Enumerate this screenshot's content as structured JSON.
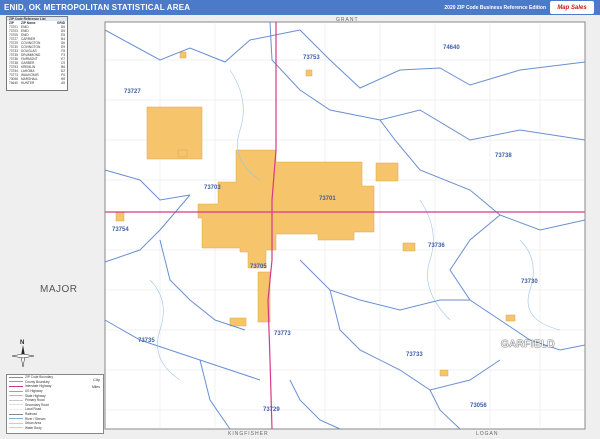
{
  "header": {
    "title": "ENID, OK METROPOLITAN STATISTICAL AREA",
    "edition": "2020 ZIP Code Business Reference Edition",
    "brand_text": "Map Sales"
  },
  "frame": {
    "top_label": "GRANT",
    "bottom_left_label": "KINGFISHER",
    "bottom_right_label": "LOGAN"
  },
  "counties": {
    "major": "MAJOR",
    "garfield": "GARFIELD"
  },
  "zip_codes": {
    "z73753": "73753",
    "z74640": "74640",
    "z73727": "73727",
    "z73738": "73738",
    "z73703": "73703",
    "z73701": "73701",
    "z73754": "73754",
    "z73736": "73736",
    "z73730": "73730",
    "z73705": "73705",
    "z73773": "73773",
    "z73735": "73735",
    "z73733": "73733",
    "z73056": "73056",
    "z73729": "73729"
  },
  "zip_table": {
    "header": "ZIP Code Reference List",
    "col_zip": "ZIP",
    "col_name": "ZIP Name",
    "col_grid": "GRID",
    "rows": [
      [
        "73701",
        "ENID",
        "D6"
      ],
      [
        "73703",
        "ENID",
        "D5"
      ],
      [
        "73705",
        "ENID",
        "E5"
      ],
      [
        "73727",
        "CARRIER",
        "B4"
      ],
      [
        "73729",
        "COVINGTON",
        "G6"
      ],
      [
        "73730",
        "COVINGTON",
        "E9"
      ],
      [
        "73733",
        "DOUGLAS",
        "F8"
      ],
      [
        "73735",
        "DRUMMOND",
        "F3"
      ],
      [
        "73736",
        "FAIRMONT",
        "E7"
      ],
      [
        "73738",
        "GARBER",
        "C9"
      ],
      [
        "73753",
        "KREMLIN",
        "B6"
      ],
      [
        "73754",
        "LAHOMA",
        "D2"
      ],
      [
        "73773",
        "WAUKOMIS",
        "F6"
      ],
      [
        "73056",
        "MARSHALL",
        "H8"
      ],
      [
        "74640",
        "HUNTER",
        "A9"
      ]
    ]
  },
  "map_legend": {
    "items": [
      {
        "label": "ZIP Code Boundary",
        "color": "#6a8fd0"
      },
      {
        "label": "County Boundary",
        "color": "#999999"
      },
      {
        "label": "Interstate Highway",
        "color": "#d43a8a"
      },
      {
        "label": "US Highway",
        "color": "#e67ab5"
      },
      {
        "label": "State Highway",
        "color": "#e9a0c6"
      },
      {
        "label": "Primary Road",
        "color": "#c8c8c8"
      },
      {
        "label": "Secondary Road",
        "color": "#dddddd"
      },
      {
        "label": "Local Road",
        "color": "#eeeeee"
      },
      {
        "label": "Railroad",
        "color": "#888888"
      },
      {
        "label": "River / Stream",
        "color": "#7fb0e0"
      },
      {
        "label": "Urban Area",
        "color": "#f5c46b"
      },
      {
        "label": "Water Body",
        "color": "#bcd6f2"
      }
    ],
    "city_label": "City",
    "scale_label": "Miles"
  },
  "compass": {
    "north": "N"
  },
  "colors": {
    "urban": "#f5c46b",
    "zip_boundary": "#6a8fd0",
    "highway": "#d43a8a",
    "outside_county": "#eaeaea",
    "title_bar": "#4a7ac8"
  }
}
